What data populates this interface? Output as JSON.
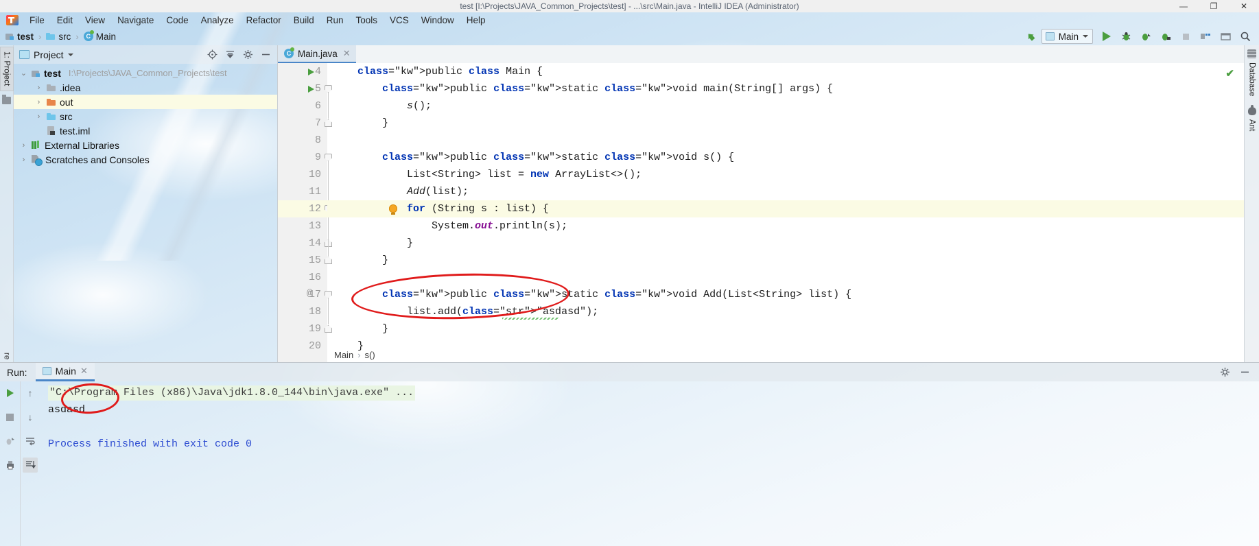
{
  "window": {
    "title": "test [I:\\Projects\\JAVA_Common_Projects\\test] - ...\\src\\Main.java - IntelliJ IDEA (Administrator)",
    "minimize": "—",
    "maximize": "❐",
    "close": "✕"
  },
  "menubar": [
    {
      "label": "File"
    },
    {
      "label": "Edit"
    },
    {
      "label": "View"
    },
    {
      "label": "Navigate"
    },
    {
      "label": "Code"
    },
    {
      "label": "Analyze"
    },
    {
      "label": "Refactor"
    },
    {
      "label": "Build"
    },
    {
      "label": "Run"
    },
    {
      "label": "Tools"
    },
    {
      "label": "VCS"
    },
    {
      "label": "Window"
    },
    {
      "label": "Help"
    }
  ],
  "breadcrumb_nav": {
    "items": [
      {
        "label": "test",
        "icon": "module-icon"
      },
      {
        "label": "src",
        "icon": "folder-icon"
      },
      {
        "label": "Main",
        "icon": "java-class-icon"
      }
    ],
    "separator": "›"
  },
  "toolbar": {
    "update_label": "⬆",
    "run_config": "Main",
    "run_tooltip": "Run",
    "debug_tooltip": "Debug",
    "coverage_tooltip": "Run with Coverage",
    "profile_tooltip": "Profile",
    "stop_tooltip": "Stop",
    "layout_tooltip": "Layout",
    "settings_tooltip": "Settings",
    "search_tooltip": "Search Everywhere"
  },
  "left_rail": {
    "project_tab": "1: Project",
    "structure_tab": "Structure",
    "favorites_tab": "re"
  },
  "project_panel": {
    "title": "Project",
    "locate_tooltip": "Select Opened File",
    "collapse_tooltip": "Collapse All",
    "settings_tooltip": "Settings",
    "hide_tooltip": "Hide",
    "tree": [
      {
        "label": "test",
        "path": "I:\\Projects\\JAVA_Common_Projects\\test",
        "icon": "module-icon",
        "arrow": "⌄",
        "indent": 0,
        "bold": true,
        "highlight": false
      },
      {
        "label": ".idea",
        "path": "",
        "icon": "folder-gray-icon",
        "arrow": "›",
        "indent": 1,
        "bold": false,
        "highlight": false
      },
      {
        "label": "out",
        "path": "",
        "icon": "folder-orange-icon",
        "arrow": "›",
        "indent": 1,
        "bold": false,
        "highlight": true
      },
      {
        "label": "src",
        "path": "",
        "icon": "folder-blue-icon",
        "arrow": "›",
        "indent": 1,
        "bold": false,
        "highlight": false
      },
      {
        "label": "test.iml",
        "path": "",
        "icon": "iml-file-icon",
        "arrow": "",
        "indent": 1,
        "bold": false,
        "highlight": false
      },
      {
        "label": "External Libraries",
        "path": "",
        "icon": "library-icon",
        "arrow": "›",
        "indent": 0,
        "bold": false,
        "highlight": false
      },
      {
        "label": "Scratches and Consoles",
        "path": "",
        "icon": "scratches-icon",
        "arrow": "›",
        "indent": 0,
        "bold": false,
        "highlight": false
      }
    ]
  },
  "editor": {
    "tab": {
      "label": "Main.java",
      "icon": "java-class-icon",
      "close": "✕"
    },
    "first_line_number": 4,
    "highlight_line": 12,
    "lines": [
      {
        "num": 4,
        "text": "public class Main {",
        "run": true,
        "fold": "none",
        "gutter": ""
      },
      {
        "num": 5,
        "text": "    public static void main(String[] args) {",
        "run": true,
        "fold": "top",
        "gutter": ""
      },
      {
        "num": 6,
        "text": "        s();",
        "run": false,
        "fold": "none",
        "gutter": ""
      },
      {
        "num": 7,
        "text": "    }",
        "run": false,
        "fold": "bot",
        "gutter": ""
      },
      {
        "num": 8,
        "text": "",
        "run": false,
        "fold": "none",
        "gutter": ""
      },
      {
        "num": 9,
        "text": "    public static void s() {",
        "run": false,
        "fold": "top",
        "gutter": ""
      },
      {
        "num": 10,
        "text": "        List<String> list = new ArrayList<>();",
        "run": false,
        "fold": "none",
        "gutter": ""
      },
      {
        "num": 11,
        "text": "        Add(list);",
        "run": false,
        "fold": "none",
        "gutter": ""
      },
      {
        "num": 12,
        "text": "        for (String s : list) {",
        "run": false,
        "fold": "top",
        "gutter": "bulb"
      },
      {
        "num": 13,
        "text": "            System.out.println(s);",
        "run": false,
        "fold": "none",
        "gutter": ""
      },
      {
        "num": 14,
        "text": "        }",
        "run": false,
        "fold": "bot",
        "gutter": ""
      },
      {
        "num": 15,
        "text": "    }",
        "run": false,
        "fold": "bot",
        "gutter": ""
      },
      {
        "num": 16,
        "text": "",
        "run": false,
        "fold": "none",
        "gutter": ""
      },
      {
        "num": 17,
        "text": "    public static void Add(List<String> list) {",
        "run": false,
        "fold": "top",
        "gutter": "@"
      },
      {
        "num": 18,
        "text": "        list.add(\"asdasd\");",
        "run": false,
        "fold": "none",
        "gutter": ""
      },
      {
        "num": 19,
        "text": "    }",
        "run": false,
        "fold": "bot",
        "gutter": ""
      },
      {
        "num": 20,
        "text": "}",
        "run": false,
        "fold": "none",
        "gutter": ""
      }
    ],
    "breadcrumbs": [
      "Main",
      "s()"
    ],
    "breadcrumb_sep": "›",
    "inspection_status": "✔"
  },
  "right_rail": {
    "database_tab": "Database",
    "ant_tab": "Ant"
  },
  "run_panel": {
    "label": "Run:",
    "tab": {
      "label": "Main",
      "close": "✕"
    },
    "settings_tooltip": "Settings",
    "hide_tooltip": "Hide",
    "side_buttons_col1": [
      "▶",
      "■",
      "⮌",
      "▤"
    ],
    "side_buttons_col2": [
      "↑",
      "↓",
      "↵",
      "↓"
    ],
    "console": [
      {
        "text": "\"C:\\Program Files (x86)\\Java\\jdk1.8.0_144\\bin\\java.exe\" ...",
        "style": "command"
      },
      {
        "text": "asdasd",
        "style": "output"
      },
      {
        "text": "",
        "style": "output"
      },
      {
        "text": "Process finished with exit code 0",
        "style": "finished"
      }
    ]
  },
  "annotations": [
    {
      "name": "code-highlight-ellipse"
    },
    {
      "name": "console-highlight-ellipse"
    }
  ],
  "colors": {
    "accent": "#4a86c8",
    "keyword": "#0033b3",
    "string": "#067d17",
    "field": "#871094",
    "annotation_red": "#e01b1b",
    "run_green": "#4a9e3f",
    "highlight_row": "#fbfbe4"
  }
}
